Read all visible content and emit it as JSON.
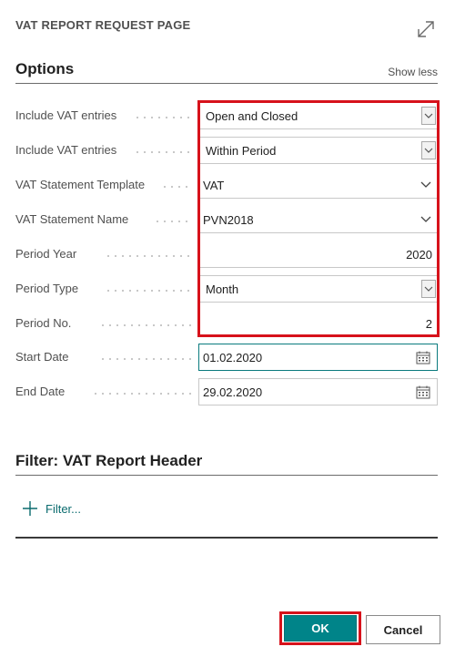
{
  "page": {
    "title": "VAT REPORT REQUEST PAGE",
    "expand_icon": "expand-diagonal-icon"
  },
  "options": {
    "title": "Options",
    "show_less_label": "Show less",
    "fields": [
      {
        "label": "Include VAT entries",
        "value": "Open and Closed",
        "control": "select"
      },
      {
        "label": "Include VAT entries",
        "value": "Within Period",
        "control": "select"
      },
      {
        "label": "VAT Statement Template",
        "value": "VAT",
        "control": "lookup"
      },
      {
        "label": "VAT Statement Name",
        "value": "PVN2018",
        "control": "lookup"
      },
      {
        "label": "Period Year",
        "value": "2020",
        "control": "number"
      },
      {
        "label": "Period Type",
        "value": "Month",
        "control": "select"
      },
      {
        "label": "Period No.",
        "value": "2",
        "control": "number"
      },
      {
        "label": "Start Date",
        "value": "01.02.2020",
        "control": "date"
      },
      {
        "label": "End Date",
        "value": "29.02.2020",
        "control": "date"
      }
    ]
  },
  "filter": {
    "title": "Filter: VAT Report Header",
    "add_filter_label": "Filter..."
  },
  "actions": {
    "ok_label": "OK",
    "cancel_label": "Cancel"
  },
  "colors": {
    "accent": "#008489",
    "highlight": "#d7121b",
    "link": "#0a6b6e"
  }
}
